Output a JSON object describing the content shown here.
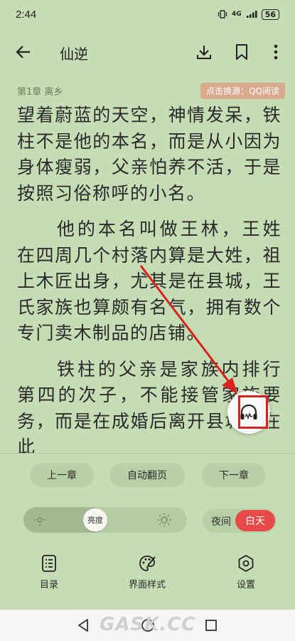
{
  "status_bar": {
    "time": "2:44",
    "network": "4G",
    "battery": "56"
  },
  "app_bar": {
    "title": "仙逆",
    "icons": [
      "back-arrow-icon",
      "download-icon",
      "bookmark-icon",
      "more-vertical-icon"
    ]
  },
  "chapter": {
    "label": "第1章 离乡",
    "source_badge": "点击换源：QQ阅读"
  },
  "content": {
    "paragraphs": [
      "望着蔚蓝的天空，神情发呆，铁柱不是他的本名，而是从小因为身体瘦弱，父亲怕养不活，于是按照习俗称呼的小名。",
      "他的本名叫做王林，王姓在四周几个村落内算是大姓，祖上木匠出身，尤其是在县城，王氏家族也算颇有名气，拥有数个专门卖木制品的店铺。",
      "铁柱的父亲是家族内排行第四的次子，不能接管家族要务，而是在成婚后离开县城，在此"
    ]
  },
  "page_controls": {
    "prev": "上一章",
    "auto": "自动翻页",
    "next": "下一章"
  },
  "brightness": {
    "label": "亮度",
    "level": 0.43
  },
  "theme_mode": {
    "night": "夜间",
    "day": "白天",
    "selected": "day",
    "active_color": "#e84a4a"
  },
  "bottom_nav": {
    "items": [
      {
        "label": "目录",
        "icon": "toc-icon"
      },
      {
        "label": "界面样式",
        "icon": "palette-icon"
      },
      {
        "label": "设置",
        "icon": "settings-icon"
      }
    ]
  },
  "listen_button": {
    "icon": "headphones-icon"
  },
  "watermark": "GASK.CC",
  "colors": {
    "background": "#c6dcb4",
    "badge": "#d9a98e",
    "highlight": "#d8221f"
  }
}
